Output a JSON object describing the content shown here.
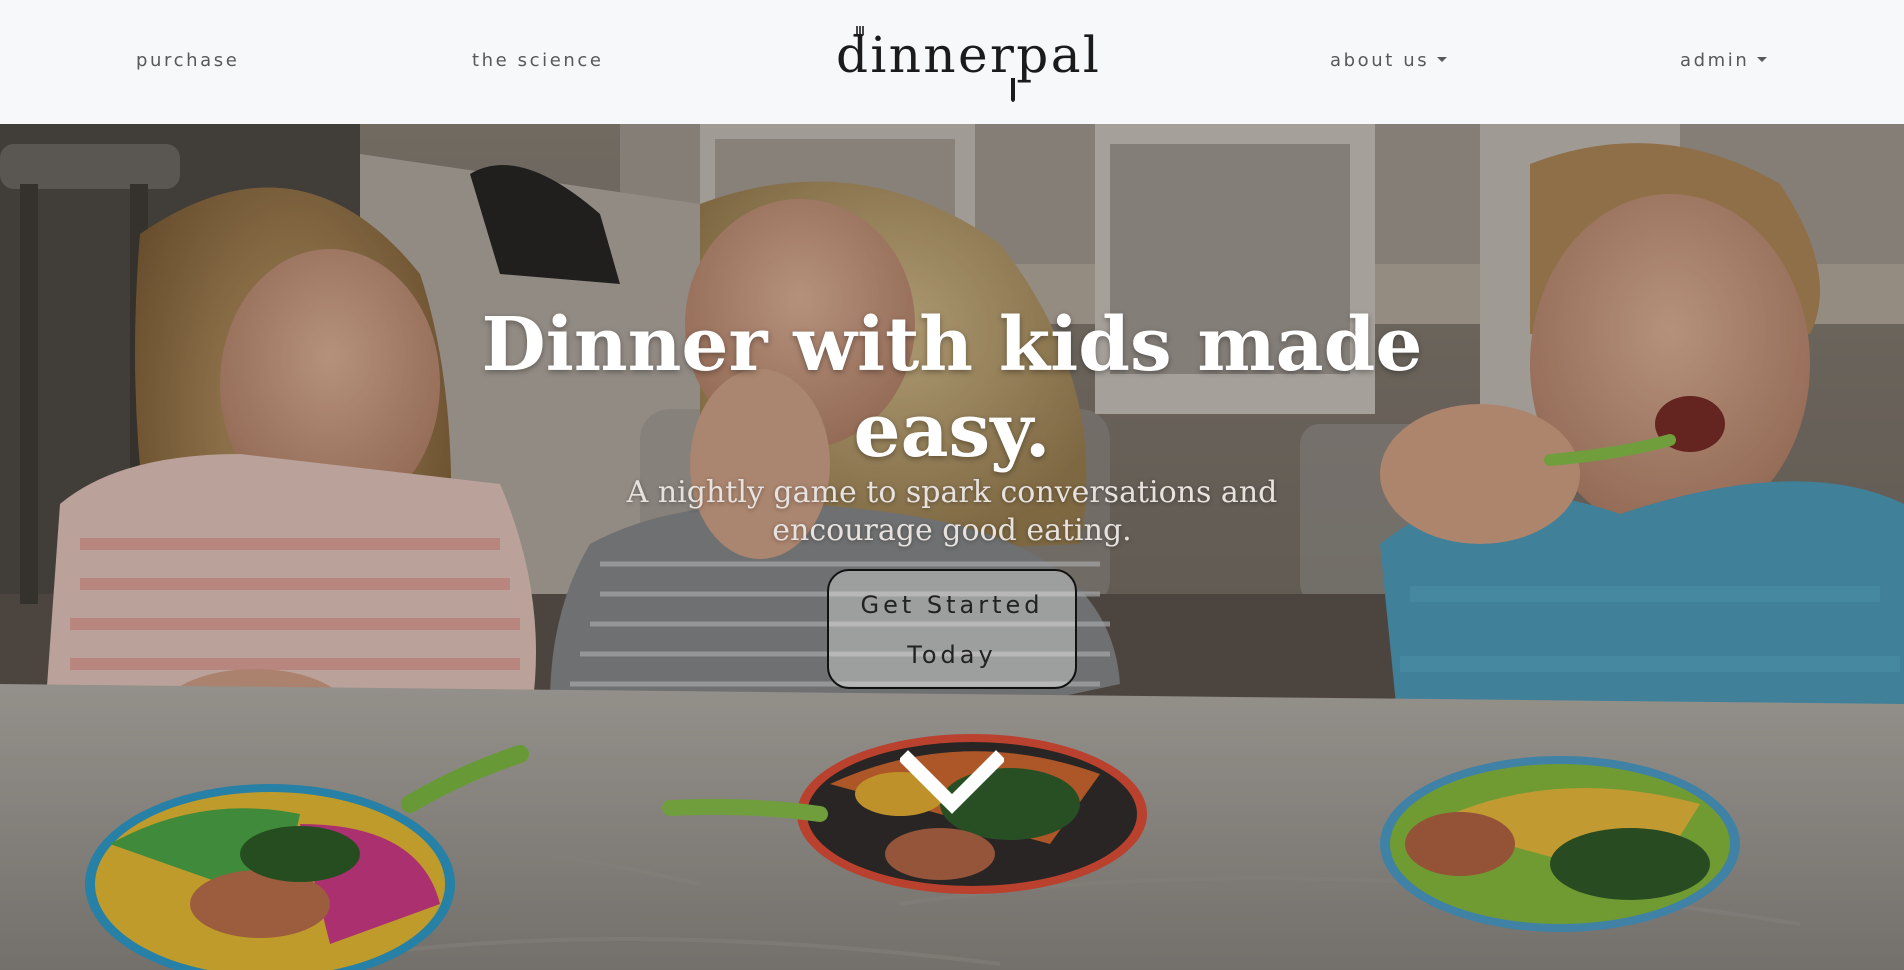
{
  "nav": {
    "purchase": "purchase",
    "science": "the science",
    "about": "about us",
    "admin": "admin"
  },
  "brand": {
    "logo_text": "dinnerpal"
  },
  "hero": {
    "headline": "Dinner with kids made easy.",
    "subheadline": "A nightly game to spark conversations and encourage good eating.",
    "cta_label": "Get Started Today",
    "scroll_icon": "chevron-down-icon"
  },
  "colors": {
    "nav_bg": "#f7f8fa",
    "nav_text": "#585858",
    "headline": "#ffffff",
    "subheadline": "#e7e2de"
  }
}
